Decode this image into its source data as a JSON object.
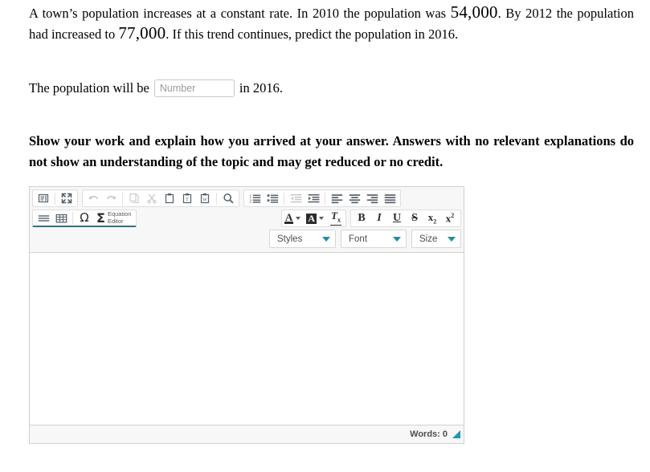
{
  "question": {
    "part1": "A town’s population increases at a constant rate. In 2010 the population was ",
    "value1": "54,000",
    "part2": ". By 2012 the population had increased to ",
    "value2": "77,000",
    "part3": ". If this trend continues, predict the population in 2016."
  },
  "answer": {
    "prefix": "The population will be",
    "input_placeholder": "Number",
    "input_value": "",
    "suffix": "in 2016."
  },
  "instructions": {
    "text": "Show your work and explain how you arrived at your answer. Answers with no relevant explanations do not show an understanding of the topic and may get reduced or no credit."
  },
  "editor": {
    "toolbar": {
      "row1": [
        {
          "group": "document",
          "buttons": [
            {
              "name": "show-blocks-button",
              "icon": "show-blocks-icon",
              "title": "Show Blocks",
              "disabled": false
            },
            {
              "name": "maximize-button",
              "icon": "maximize-icon",
              "title": "Maximize",
              "disabled": false
            }
          ]
        },
        {
          "group": "clipboard",
          "buttons": [
            {
              "name": "undo-button",
              "icon": "undo-arrow-icon",
              "title": "Undo",
              "disabled": true
            },
            {
              "name": "redo-button",
              "icon": "redo-arrow-icon",
              "title": "Redo",
              "disabled": true
            },
            {
              "name": "copy-button",
              "icon": "copy-icon",
              "title": "Copy",
              "disabled": true
            },
            {
              "name": "cut-button",
              "icon": "scissors-icon",
              "title": "Cut",
              "disabled": true
            },
            {
              "name": "paste-button",
              "icon": "clipboard-icon",
              "title": "Paste",
              "disabled": false
            },
            {
              "name": "paste-text-button",
              "icon": "clipboard-text-icon",
              "title": "Paste as plain text",
              "disabled": false
            },
            {
              "name": "paste-word-button",
              "icon": "clipboard-word-icon",
              "title": "Paste from Word",
              "disabled": false
            },
            {
              "name": "find-button",
              "icon": "magnifier-icon",
              "title": "Find",
              "disabled": false
            }
          ]
        },
        {
          "group": "paragraph",
          "buttons": [
            {
              "name": "numbered-list-button",
              "icon": "numbered-list-icon",
              "title": "Insert/Remove Numbered List",
              "disabled": false
            },
            {
              "name": "bulleted-list-button",
              "icon": "bulleted-list-icon",
              "title": "Insert/Remove Bulleted List",
              "disabled": false
            },
            {
              "name": "outdent-button",
              "icon": "outdent-icon",
              "title": "Decrease Indent",
              "disabled": true
            },
            {
              "name": "indent-button",
              "icon": "indent-icon",
              "title": "Increase Indent",
              "disabled": false
            },
            {
              "name": "align-left-button",
              "icon": "align-left-icon",
              "title": "Align Left",
              "disabled": false
            },
            {
              "name": "align-center-button",
              "icon": "align-center-icon",
              "title": "Center",
              "disabled": false
            },
            {
              "name": "align-right-button",
              "icon": "align-right-icon",
              "title": "Align Right",
              "disabled": false
            },
            {
              "name": "justify-button",
              "icon": "justify-icon",
              "title": "Justify",
              "disabled": false
            }
          ]
        }
      ],
      "row2": [
        {
          "group": "insert",
          "buttons": [
            {
              "name": "horizontal-rule-button",
              "icon": "horizontal-rule-icon",
              "title": "Insert Horizontal Line",
              "disabled": false
            },
            {
              "name": "table-button",
              "icon": "table-icon",
              "title": "Table",
              "disabled": false
            },
            {
              "name": "special-char-button",
              "icon": "omega-icon",
              "glyph": "Ω",
              "title": "Insert Special Character",
              "disabled": false
            }
          ]
        },
        {
          "group": "equation",
          "sigma": "Σ",
          "label_line1": "Equation",
          "label_line2": "Editor",
          "name": "equation-editor-button"
        },
        {
          "group": "colors",
          "buttons": [
            {
              "name": "text-color-button",
              "icon": "text-color-icon",
              "glyph": "A",
              "title": "Text Color"
            },
            {
              "name": "background-color-button",
              "icon": "background-color-icon",
              "glyph": "A",
              "title": "Background Color"
            },
            {
              "name": "remove-format-button",
              "icon": "remove-format-icon",
              "glyph": "T",
              "title": "Remove Format"
            }
          ]
        },
        {
          "group": "basicstyles",
          "buttons": [
            {
              "name": "bold-button",
              "icon": "bold-icon",
              "glyph": "B",
              "title": "Bold"
            },
            {
              "name": "italic-button",
              "icon": "italic-icon",
              "glyph": "I",
              "title": "Italic"
            },
            {
              "name": "underline-button",
              "icon": "underline-icon",
              "glyph": "U",
              "title": "Underline"
            },
            {
              "name": "strikethrough-button",
              "icon": "strikethrough-icon",
              "glyph": "S",
              "title": "Strikethrough"
            },
            {
              "name": "subscript-button",
              "icon": "subscript-icon",
              "glyph": "x",
              "sub": "2",
              "title": "Subscript"
            },
            {
              "name": "superscript-button",
              "icon": "superscript-icon",
              "glyph": "x",
              "sup": "2",
              "title": "Superscript"
            }
          ]
        }
      ],
      "combos": {
        "styles": "Styles",
        "font": "Font",
        "size": "Size"
      }
    },
    "content_value": "",
    "footer": {
      "words_label": "Words: 0"
    }
  },
  "colors": {
    "combo_arrow": "#1a8fa8",
    "resizer": "#1a9ab5",
    "toolbar_bg": "#f7f7f7",
    "editor_border": "#d1d1d1",
    "group_underline": "#3e6c7b"
  }
}
